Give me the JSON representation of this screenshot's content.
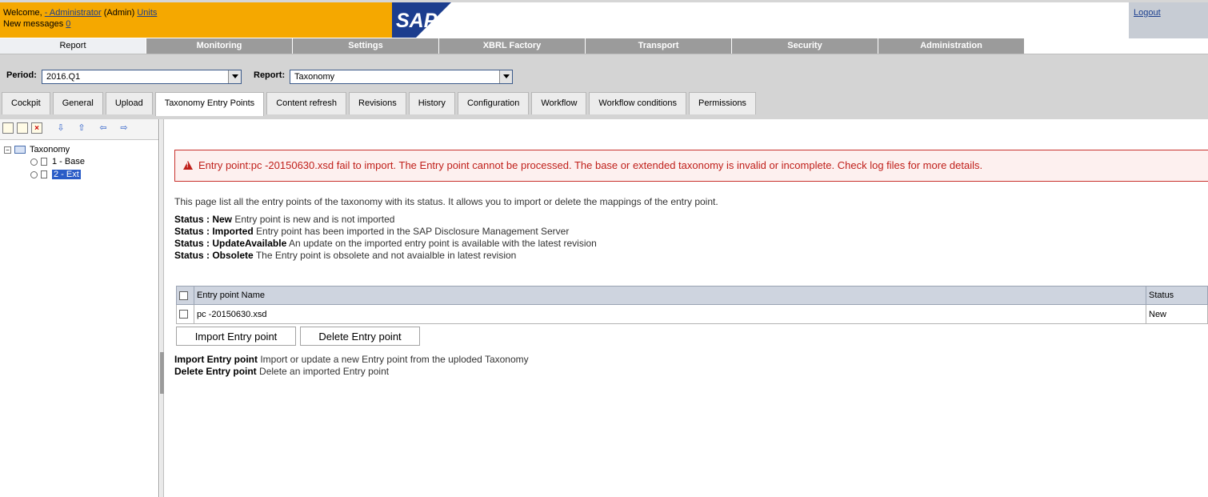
{
  "header": {
    "welcome_prefix": "Welcome, ",
    "user_link": "- Administrator",
    "role": " (Admin) ",
    "units_link": "Units",
    "messages_label": "New messages ",
    "messages_count": "0",
    "logo_text": "SAP",
    "logout_label": "Logout"
  },
  "main_nav": [
    {
      "label": "Report",
      "active": true
    },
    {
      "label": "Monitoring"
    },
    {
      "label": "Settings"
    },
    {
      "label": "XBRL Factory"
    },
    {
      "label": "Transport"
    },
    {
      "label": "Security"
    },
    {
      "label": "Administration"
    }
  ],
  "filters": {
    "period_label": "Period:",
    "period_value": "2016.Q1",
    "report_label": "Report:",
    "report_value": "Taxonomy"
  },
  "sub_tabs": [
    {
      "label": "Cockpit"
    },
    {
      "label": "General"
    },
    {
      "label": "Upload"
    },
    {
      "label": "Taxonomy Entry Points",
      "active": true
    },
    {
      "label": "Content refresh"
    },
    {
      "label": "Revisions"
    },
    {
      "label": "History"
    },
    {
      "label": "Configuration"
    },
    {
      "label": "Workflow"
    },
    {
      "label": "Workflow conditions"
    },
    {
      "label": "Permissions"
    }
  ],
  "tree": {
    "root": "Taxonomy",
    "children": [
      "1 - Base",
      "2 - Ext"
    ],
    "selected": "2 - Ext"
  },
  "error_message": "Entry point:pc -20150630.xsd fail to import. The Entry point cannot be processed. The base or extended taxonomy is invalid or incomplete. Check log files for more details.",
  "description": "This page list all the entry points of the taxonomy with its status. It allows you to import or delete the mappings of the entry point.",
  "statuses": [
    {
      "prefix": "Status : ",
      "name": "New",
      "text": " Entry point is new and is not imported"
    },
    {
      "prefix": "Status : ",
      "name": "Imported",
      "text": " Entry point has been imported in the SAP Disclosure Management Server"
    },
    {
      "prefix": "Status : ",
      "name": "UpdateAvailable",
      "text": " An update on the imported entry point is available with the latest revision"
    },
    {
      "prefix": "Status : ",
      "name": "Obsolete",
      "text": " The Entry point is obsolete and not avaialble in latest revision"
    }
  ],
  "table": {
    "headers": [
      "Entry point Name",
      "Status"
    ],
    "rows": [
      {
        "name": "pc  -20150630.xsd",
        "status": "New"
      }
    ]
  },
  "buttons": {
    "import": "Import Entry point",
    "delete": "Delete Entry point"
  },
  "help": [
    {
      "name": "Import Entry point",
      "text": " Import or update a new Entry point from the uploded Taxonomy"
    },
    {
      "name": "Delete Entry point",
      "text": " Delete an imported Entry point"
    }
  ]
}
